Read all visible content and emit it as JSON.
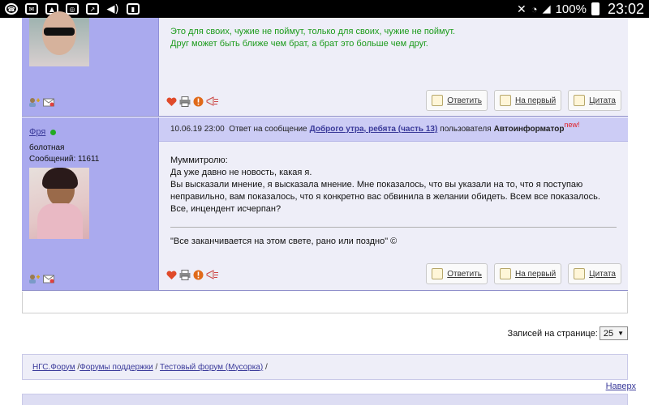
{
  "status_bar": {
    "battery": "100%",
    "time": "23:02",
    "left_icons": [
      "whatsapp-icon",
      "email-icon",
      "gallery-icon",
      "instagram-icon",
      "screencast-icon",
      "volume-icon",
      "sd-card-icon"
    ],
    "right_icons": [
      "silent-icon",
      "wifi-icon",
      "signal-icon",
      "battery-icon"
    ]
  },
  "post1": {
    "text_line1": "Это для своих, чужие не поймут, только для своих, чужие не поймут.",
    "text_line2": "Друг может быть ближе чем брат, а брат это больше чем друг.",
    "buttons": {
      "reply": "Ответить",
      "first": "На первый",
      "quote": "Цитата"
    }
  },
  "post2": {
    "author": "Фря",
    "status": "болотная",
    "messages": "Сообщений: 11611",
    "date": "10.06.19 23:00",
    "reply_prefix": "Ответ на сообщение",
    "reply_topic": "Доброго утра, ребята (часть 13)",
    "reply_user_prefix": "пользователя",
    "reply_user": "Автоинформатор",
    "new_tag": "new!",
    "body": [
      "Муммитролю:",
      "Да уже давно не новость, какая я.",
      "Вы высказали мнение, я высказала мнение. Мне показалось, что вы указали на то, что я поступаю",
      "неправильно, вам показалось, что я конкретно вас обвинила в желании обидеть. Всем все показалось.",
      "Все, инцендент исчерпан?"
    ],
    "signature": "\"Все заканчивается на этом свете, рано или поздно\" ©",
    "buttons": {
      "reply": "Ответить",
      "first": "На первый",
      "quote": "Цитата"
    }
  },
  "pagination": {
    "label": "Записей на странице:",
    "value": "25"
  },
  "breadcrumb": {
    "items": [
      "НГС.Форум",
      "Форумы поддержки",
      "Тестовый форум (Мусорка)"
    ]
  },
  "back_to_top": "Наверх",
  "colors": {
    "sidebar": "#aaaaee",
    "post_bg": "#eeeef8",
    "header_bg": "#ccccf5",
    "green": "#1c9b1c",
    "link": "#3a3a9a"
  }
}
